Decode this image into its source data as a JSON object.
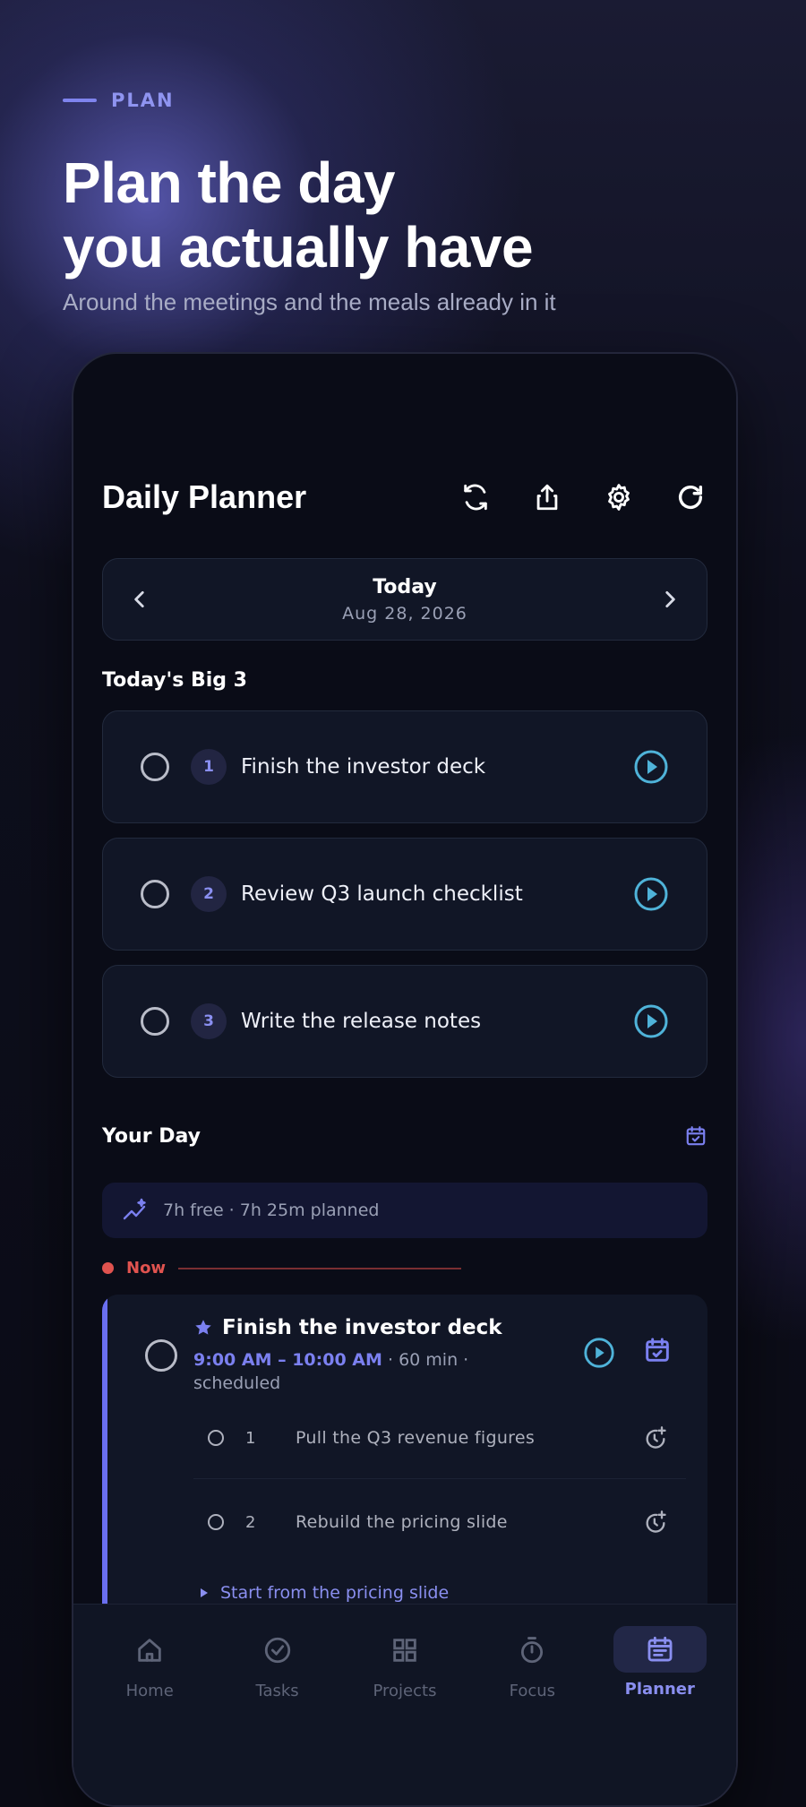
{
  "hero": {
    "eyebrow": "PLAN",
    "title_line1": "Plan the day",
    "title_line2": "you actually have",
    "subtitle": "Around the meetings and the meals already in it"
  },
  "app": {
    "title": "Daily Planner",
    "header_icons": [
      "sync-icon",
      "share-icon",
      "settings-icon",
      "refresh-icon"
    ]
  },
  "date_nav": {
    "label": "Today",
    "date": "Aug 28, 2026"
  },
  "big3": {
    "title": "Today's Big 3",
    "items": [
      {
        "num": "1",
        "text": "Finish the investor deck"
      },
      {
        "num": "2",
        "text": "Review Q3 launch checklist"
      },
      {
        "num": "3",
        "text": "Write the release notes"
      }
    ]
  },
  "your_day": {
    "title": "Your Day",
    "summary": "7h free · 7h 25m planned",
    "now_label": "Now"
  },
  "event": {
    "title": "Finish the investor deck",
    "time": "9:00 AM – 10:00 AM",
    "duration": "60 min",
    "status": "scheduled",
    "subtasks": [
      {
        "num": "1",
        "text": "Pull the Q3 revenue figures"
      },
      {
        "num": "2",
        "text": "Rebuild the pricing slide"
      }
    ],
    "hint": "Start from the pricing slide"
  },
  "tabs": [
    {
      "label": "Home",
      "icon": "home-icon"
    },
    {
      "label": "Tasks",
      "icon": "check-circle-icon"
    },
    {
      "label": "Projects",
      "icon": "grid-icon"
    },
    {
      "label": "Focus",
      "icon": "timer-icon"
    },
    {
      "label": "Planner",
      "icon": "planner-icon",
      "active": true
    }
  ],
  "colors": {
    "accent": "#7b80f0",
    "play": "#4fb3d9",
    "now": "#e0534f",
    "background": "#0b0c16"
  }
}
